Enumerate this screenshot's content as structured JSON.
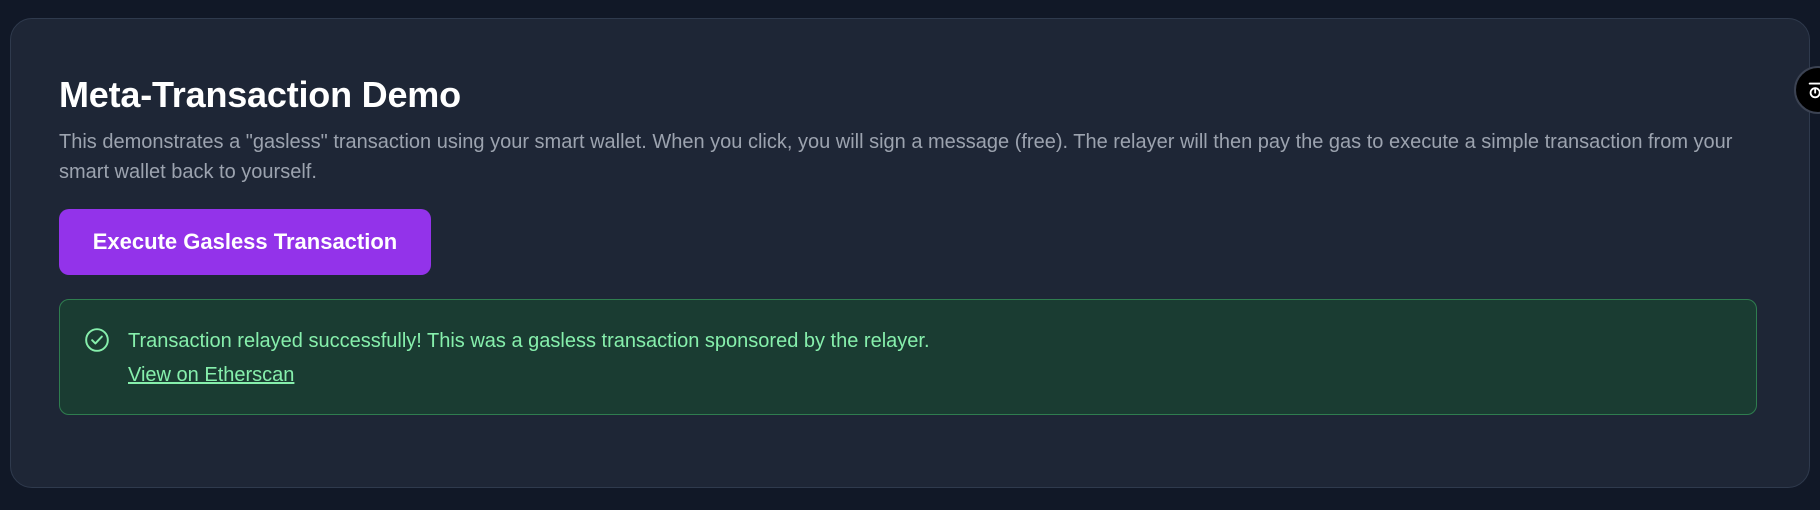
{
  "demo": {
    "title": "Meta-Transaction Demo",
    "description": "This demonstrates a \"gasless\" transaction using your smart wallet. When you click, you will sign a message (free). The relayer will then pay the gas to execute a simple transaction from your smart wallet back to yourself.",
    "execute_button_label": "Execute Gasless Transaction",
    "alert": {
      "status": "success",
      "icon": "check-circle-icon",
      "message": "Transaction relayed successfully! This was a gasless transaction sponsored by the relayer.",
      "link_text": "View on Etherscan"
    }
  },
  "floating_button": {
    "icon": "toolbar-toggle-icon"
  },
  "colors": {
    "background": "#111827",
    "card": "#1e2636",
    "accent_purple": "#9333ea",
    "success_bg": "#1a3c32",
    "success_text": "#86efac",
    "success_border": "#2f7d4f"
  }
}
